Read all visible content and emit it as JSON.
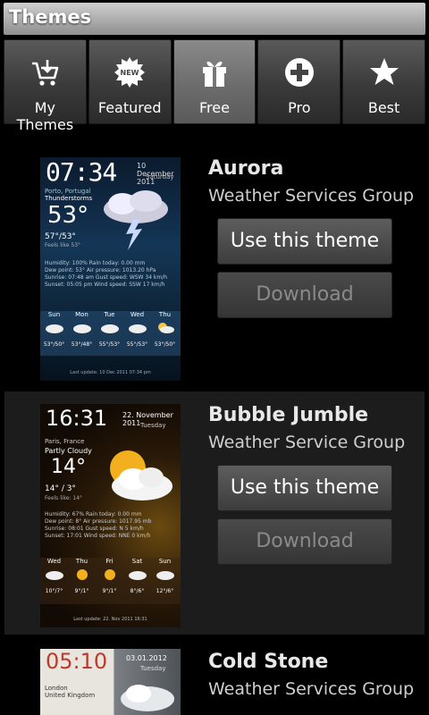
{
  "title": "Themes",
  "tabs": [
    {
      "label": "My Themes",
      "icon": "cart-download-icon"
    },
    {
      "label": "Featured",
      "icon": "new-badge-icon"
    },
    {
      "label": "Free",
      "icon": "gift-icon",
      "selected": true
    },
    {
      "label": "Pro",
      "icon": "plus-circle-icon"
    },
    {
      "label": "Best",
      "icon": "star-icon"
    }
  ],
  "themes": [
    {
      "name": "Aurora",
      "author": "Weather Services Group",
      "use_label": "Use this theme",
      "download_label": "Download",
      "preview": {
        "time": "07:34",
        "date": "10 December 2011",
        "day": "Saturday",
        "location": "Porto, Portugal",
        "condition": "Thunderstorms",
        "temp": "53°",
        "hilo": "57°/53°",
        "feels": "Feels like 53°",
        "details": [
          "Humidity: 100%   Rain today: 0.00 mm",
          "Dew point: 53°   Air pressure: 1013.20 hPa",
          "Sunrise: 07:48 am   Gust speed: WSW 34 km/h",
          "Sunset: 05:05 pm   Wind speed: SSW 17 km/h"
        ],
        "forecast": [
          {
            "day": "Sun",
            "temp": "53°/50°"
          },
          {
            "day": "Mon",
            "temp": "53°/48°"
          },
          {
            "day": "Tue",
            "temp": "55°/53°"
          },
          {
            "day": "Wed",
            "temp": "55°/53°"
          },
          {
            "day": "Thu",
            "temp": "53°/50°"
          }
        ],
        "footer": "Last update: 10 Dec 2011 07:34 pm"
      }
    },
    {
      "name": "Bubble Jumble",
      "author": "Weather Service Group",
      "use_label": "Use this theme",
      "download_label": "Download",
      "preview": {
        "time": "16:31",
        "date": "22. November 2011",
        "day": "Tuesday",
        "location": "Paris, France",
        "condition": "Partly Cloudy",
        "temp": "14°",
        "hilo": "14° / 3°",
        "feels": "Feels like: 14°",
        "details": [
          "Humidity: 67%   Rain today: 0.00 mm",
          "Dew point: 8°   Air pressure: 1017.95 mb",
          "Sunrise: 08:01   Gust speed: N 5 km/h",
          "Sunset: 17:01   Wind speed: NNE 0 km/h"
        ],
        "forecast": [
          {
            "day": "Wed",
            "temp": "10°/7°"
          },
          {
            "day": "Thu",
            "temp": "9°/1°"
          },
          {
            "day": "Fri",
            "temp": "9°/1°"
          },
          {
            "day": "Sat",
            "temp": "8°/6°"
          },
          {
            "day": "Sun",
            "temp": "12°/6°"
          }
        ],
        "footer": "Last update: 22. Nov 2011 16:31"
      }
    },
    {
      "name": "Cold Stone",
      "author": "Weather Services Group",
      "preview": {
        "time": "05:10",
        "date": "03.01.2012",
        "day": "Tuesday",
        "location": "London",
        "condition": "United Kingdom"
      }
    }
  ],
  "colors": {
    "accent_selected": "#6c6c6c",
    "background": "#000000",
    "alt_row": "#1c1c1c",
    "stone_time": "#c0392b"
  }
}
